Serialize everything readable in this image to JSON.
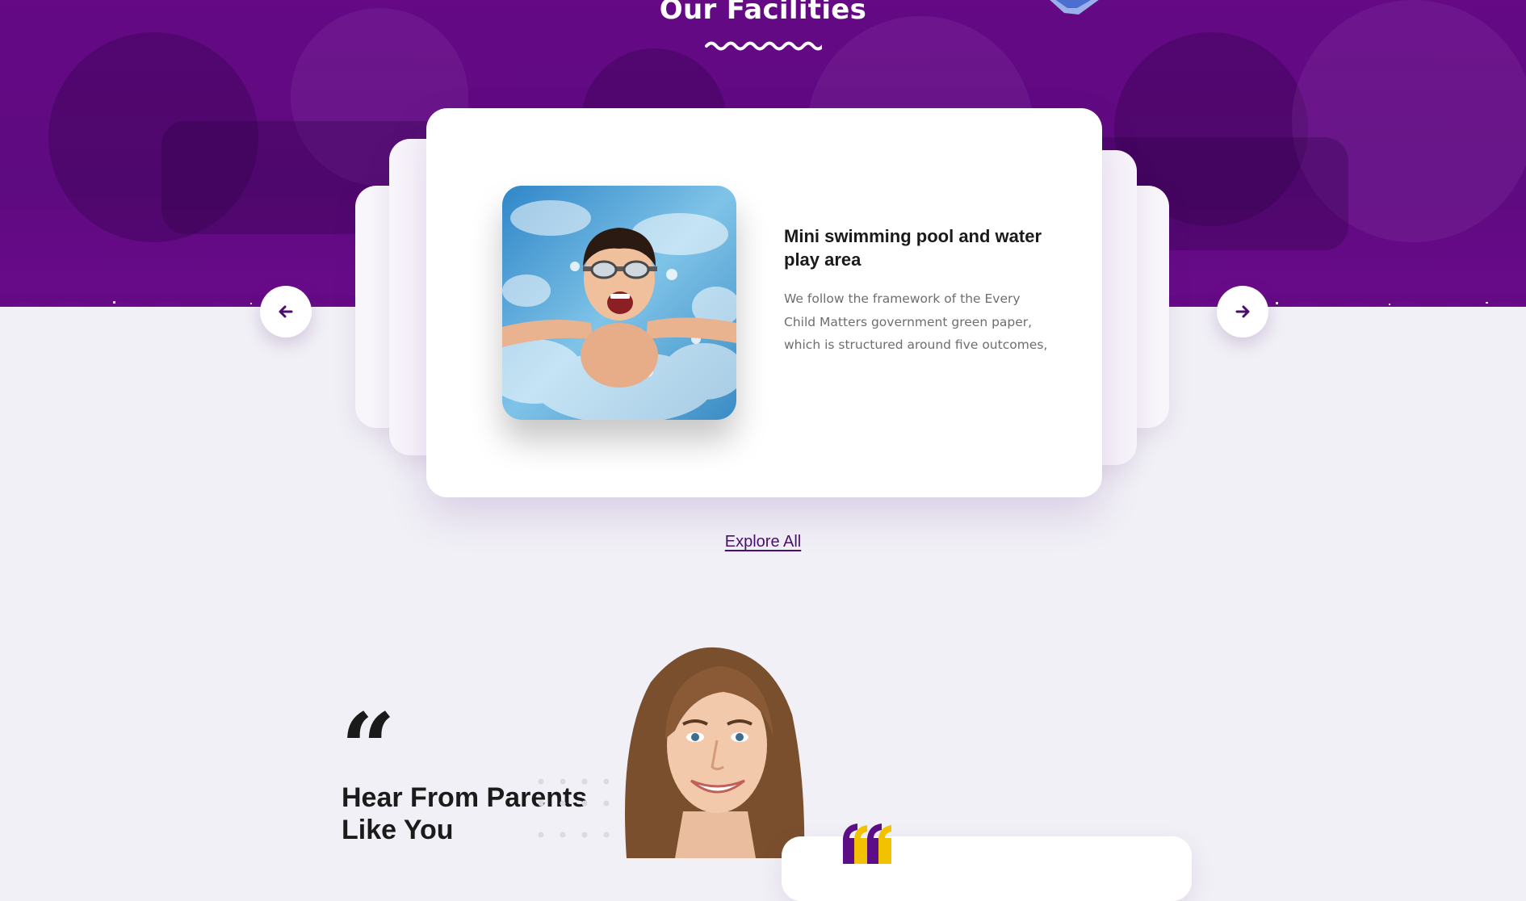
{
  "facilities": {
    "section_title": "Our Facilities",
    "active_card": {
      "title": "Mini swimming pool and water play area",
      "description": "We follow the framework of the Every Child Matters government green paper, which is structured around five outcomes,",
      "image_icon": "photo-child-swimming-pool"
    },
    "prev_icon": "arrow-left-icon",
    "next_icon": "arrow-right-icon",
    "explore_label": "Explore All"
  },
  "testimonials": {
    "quote_glyph": "“",
    "heading_line1": "Hear From Parents",
    "heading_line2": "Like You",
    "photo_icon": "parent-portrait-photo"
  },
  "colors": {
    "brand_purple": "#650985",
    "accent_yellow": "#f2c200",
    "page_background": "#f1f0f6"
  }
}
